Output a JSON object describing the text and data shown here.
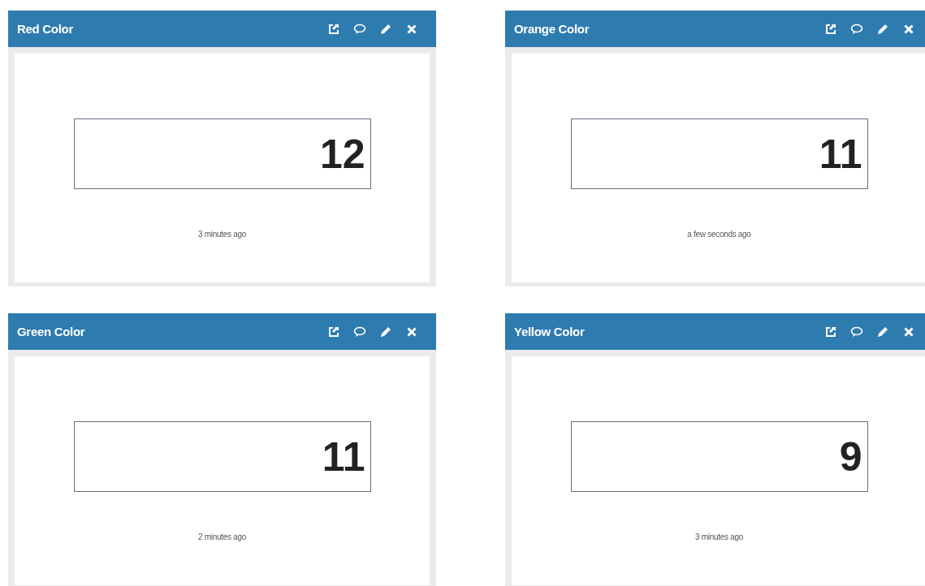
{
  "widgets": [
    {
      "title": "Red Color",
      "value": "12",
      "updated": "3 minutes ago"
    },
    {
      "title": "Orange Color",
      "value": "11",
      "updated": "a few seconds ago"
    },
    {
      "title": "Green Color",
      "value": "11",
      "updated": "2 minutes ago"
    },
    {
      "title": "Yellow Color",
      "value": "9",
      "updated": "3 minutes ago"
    }
  ]
}
